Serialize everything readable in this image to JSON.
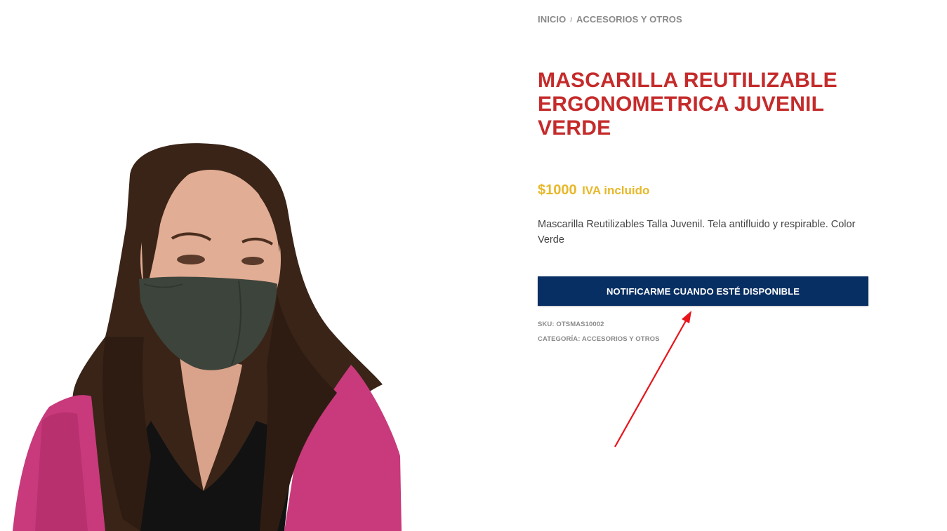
{
  "breadcrumb": {
    "home": "INICIO",
    "separator": "/",
    "category": "ACCESORIOS Y OTROS"
  },
  "product": {
    "title": "MASCARILLA REUTILIZABLE ERGONOMETRICA JUVENIL VERDE",
    "price": "$1000",
    "price_suffix": "IVA incluido",
    "description": "Mascarilla Reutilizables Talla Juvenil. Tela antifluido y respirable. Color Verde",
    "notify_button": "NOTIFICARME CUANDO ESTÉ DISPONIBLE",
    "sku_label": "SKU:",
    "sku_value": "OTSMAS10002",
    "category_label": "CATEGORÍA:",
    "category_value": "ACCESORIOS Y OTROS"
  },
  "colors": {
    "title": "#c52b2b",
    "price": "#e7b82a",
    "button_bg": "#082f63",
    "button_text": "#ffffff",
    "annotation_arrow": "#e8141b"
  }
}
